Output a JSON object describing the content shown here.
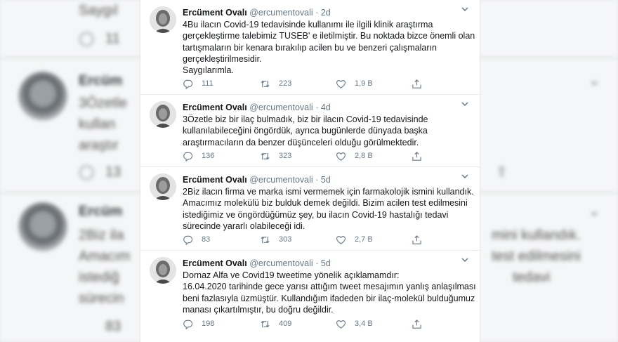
{
  "background": {
    "fragments": [
      {
        "text": "Saygıl"
      },
      {
        "text": "Ercüm"
      },
      {
        "text": "3Özetle"
      },
      {
        "text": "kullan"
      },
      {
        "text": "araştır"
      },
      {
        "text": "Ercüm"
      },
      {
        "text": "2Biz ila"
      },
      {
        "text": "Amacım"
      },
      {
        "text": "istediğ"
      },
      {
        "text": "sürecin"
      },
      {
        "text": "mini kullandık."
      },
      {
        "text": "test edilmesini"
      },
      {
        "text": "tedavi"
      }
    ],
    "counts": [
      "11",
      "13",
      "83"
    ]
  },
  "tweets": [
    {
      "name": "Ercüment Ovalı",
      "handle": "@ercumentovali",
      "sep": "·",
      "time": "2d",
      "lines": [
        "4Bu ilacın Covid-19 tedavisinde kullanımı ile ilgili klinik araştırma",
        "gerçekleştirme talebimiz TUSEB' e iletilmiştir. Bu noktada bizce önemli olan",
        "tartışmaların bir kenara bırakılıp acilen bu ve benzeri çalışmaların",
        "gerçekleştirilmesidir.",
        "Saygılarımla."
      ],
      "replies": "111",
      "retweets": "223",
      "likes": "1,9 B"
    },
    {
      "name": "Ercüment Ovalı",
      "handle": "@ercumentovali",
      "sep": "·",
      "time": "4d",
      "lines": [
        "3Özetle biz bir ilaç bulmadık, biz bir ilacın Covid-19 tedavisinde",
        "kullanılabileceğini öngördük, ayrıca bugünlerde dünyada başka",
        "araştırmacıların da benzer düşünceleri olduğu görülmektedir."
      ],
      "replies": "136",
      "retweets": "323",
      "likes": "2,8 B"
    },
    {
      "name": "Ercüment Ovalı",
      "handle": "@ercumentovali",
      "sep": "·",
      "time": "5d",
      "lines": [
        "2Biz ilacın firma ve marka ismi vermemek için farmakolojik ismini kullandık.",
        "Amacımız molekülü biz bulduk demek değildi. Bizim acilen test edilmesini",
        "istediğimiz ve öngördüğümüz şey, bu ilacın Covid-19 hastalığı tedavi",
        "sürecinde yararlı olabileceği idi."
      ],
      "replies": "83",
      "retweets": "303",
      "likes": "2,7 B"
    },
    {
      "name": "Ercüment Ovalı",
      "handle": "@ercumentovali",
      "sep": "·",
      "time": "5d",
      "lines": [
        "Dornaz Alfa ve Covid19 tweetime yönelik açıklamamdır:",
        "16.04.2020 tarihinde gece yarısı attığım tweet mesajımın yanlış anlaşılması",
        "beni fazlasıyla üzmüştür. Kullandığım ifadeden bir ilaç-molekül bulduğumuz",
        "manası çıkartılmıştır, bu doğru değildir."
      ],
      "replies": "198",
      "retweets": "409",
      "likes": "3,4 B"
    }
  ],
  "icons": {
    "reply": "reply-icon",
    "retweet": "retweet-icon",
    "like": "heart-icon",
    "share": "share-icon",
    "more": "chevron-down-icon"
  },
  "colors": {
    "text": "#14171a",
    "muted": "#657786",
    "divider": "#e6ecf0",
    "background": "#e9eaeb"
  }
}
